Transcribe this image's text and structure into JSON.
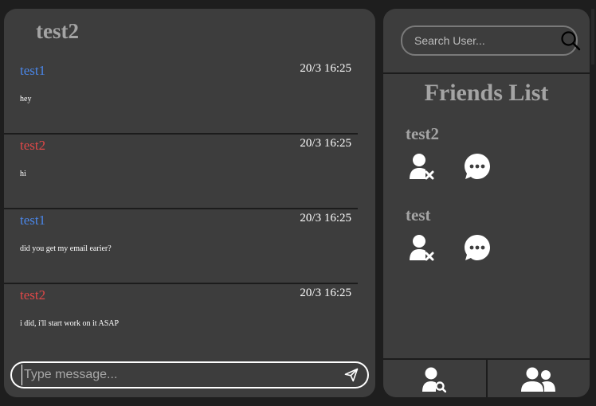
{
  "chat": {
    "title": "test2",
    "messages": [
      {
        "user": "test1",
        "time": "20/3 16:25",
        "text": "hey"
      },
      {
        "user": "test2",
        "time": "20/3 16:25",
        "text": "hi"
      },
      {
        "user": "test1",
        "time": "20/3 16:25",
        "text": "did you get my email earier?"
      },
      {
        "user": "test2",
        "time": "20/3 16:25",
        "text": "i did, i'll start work on it ASAP"
      }
    ],
    "input_placeholder": "Type message..."
  },
  "sidebar": {
    "search_placeholder": "Search User...",
    "friends_title": "Friends List",
    "friends": [
      {
        "name": "test2"
      },
      {
        "name": "test"
      }
    ]
  },
  "icons": {
    "send": "send-icon",
    "search": "search-icon",
    "remove_friend": "user-remove-icon",
    "chat": "chat-bubble-icon",
    "find_user": "user-search-icon",
    "friends": "users-icon"
  },
  "colors": {
    "panel": "#3d3d3d",
    "background": "#1e1e1e",
    "heading": "#a4a4a4",
    "user_test1": "#4a86e8",
    "user_test2": "#e04848"
  }
}
